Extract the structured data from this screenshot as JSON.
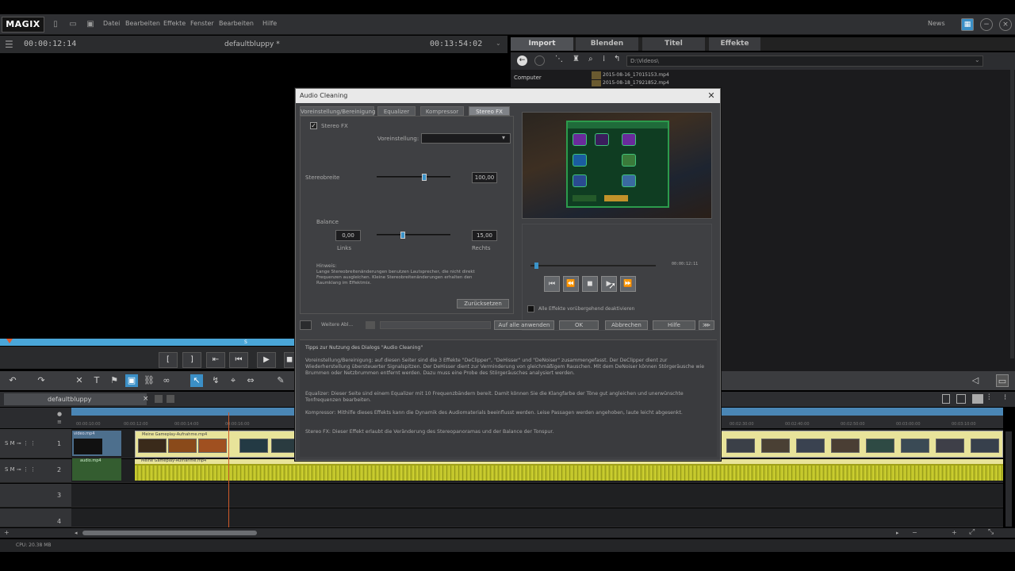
{
  "menubar": {
    "logo": "MAGIX",
    "items": [
      "Datei",
      "Bearbeiten",
      "Effekte",
      "Fenster",
      "Bearbeiten",
      "Hilfe"
    ],
    "right_label": "News"
  },
  "preview": {
    "position": "00:00:12:14",
    "project": "defaultbluppy *",
    "duration": "00:13:54:02"
  },
  "mediapool": {
    "tabs": [
      "Import",
      "Blenden",
      "Titel",
      "Effekte"
    ],
    "active_tab": "Import",
    "path": "D:\\Videos\\",
    "tree_label": "Computer",
    "files": [
      "2015-08-16_17015153.mp4",
      "2015-08-18_17921852.mp4"
    ]
  },
  "dialog": {
    "title": "Audio Cleaning",
    "tabs": [
      "Voreinstellung/Bereinigung",
      "Equalizer",
      "Kompressor",
      "Stereo FX"
    ],
    "active_tab": "Stereo FX",
    "checkbox_label": "Stereo FX",
    "preset_label": "Voreinstellung:",
    "preset_value": "",
    "stereo_width_label": "Stereobreite",
    "stereo_width_value": "100,00",
    "stereo_width_pct": 0.65,
    "balance_label": "Balance",
    "balance_left_value": "0,00",
    "balance_right_value": "15,00",
    "balance_pct": 0.35,
    "left_label": "Links",
    "right_label": "Rechts",
    "hint_title": "Hinweis:",
    "hint_text": "Lange Stereobreitenänderungen benutzen Lautsprecher, die nicht direkt Frequenzen ausgleichen. Kleine Stereobreitenänderungen erhalten den Raumklang im Effektmix.",
    "reset_button": "Zurücksetzen",
    "time_readout": "00:00:12:11",
    "seek_pct": 0.03,
    "play_all_label": "Alle Effekte vorübergehend deaktivieren",
    "bottom_buttons": {
      "settings": "Weitere Abl...",
      "apply_all": "Auf alle anwenden",
      "ok": "OK",
      "cancel": "Abbrechen",
      "help": "Hilfe"
    },
    "help": {
      "title": "Tipps zur Nutzung des Dialogs \"Audio Cleaning\"",
      "p1": "Voreinstellung/Bereinigung: auf diesen Seiter sind die 3 Effekte \"DeClipper\", \"DeHisser\" und \"DeNoiser\" zusammengefasst. Der DeClipper dient zur Wiederherstellung übersteuerter Signalspitzen. Der DeHisser dient zur Verminderung von gleichmäßigem Rauschen. Mit dem DeNoiser können Störgeräusche wie Brummen oder Netzbrummen entfernt werden. Dazu muss eine Probe des Störgeräusches analysiert werden.",
      "p2": "Equalizer: Dieser Seite sind einem Equalizer mit 10 Frequenzbändern bereit. Damit können Sie die Klangfarbe der Töne gut angleichen und unerwünschte Tonfrequenzen bearbeiten.",
      "p3": "Kompressor: Mithilfe dieses Effekts kann die Dynamik des Audiomaterials beeinflusst werden. Leise Passagen werden angehoben, laute leicht abgesenkt.",
      "p4": "Stereo FX: Dieser Effekt erlaubt die Veränderung des Stereopanoramas und der Balance der Tonspur."
    }
  },
  "timeline": {
    "project_tab": "defaultbluppy",
    "ruler_marks": [
      "00:00:10:00",
      "00:00:12:00",
      "00:00:14:00",
      "00:00:16:00",
      "00:02:30:00",
      "00:02:40:00",
      "00:02:50:00",
      "00:03:00:00",
      "00:03:10:00"
    ],
    "tracks": [
      {
        "num": "1",
        "controls": "S M ⊸ ⋮ ⋮"
      },
      {
        "num": "2",
        "controls": "S M ⊸ ⋮ ⋮"
      },
      {
        "num": "3",
        "controls": ""
      },
      {
        "num": "4",
        "controls": ""
      }
    ],
    "clip_video_label": "Meine Gameplay-Aufnahme.mp4",
    "clip_audio_label": "Meine Gameplay-Aufnahme.mp4",
    "src_video_label": "video.mp4",
    "src_audio_label": "audio.mp4"
  },
  "transport": {
    "marker_label": "S"
  },
  "status": {
    "cpu": "CPU: 20.38 MB"
  }
}
